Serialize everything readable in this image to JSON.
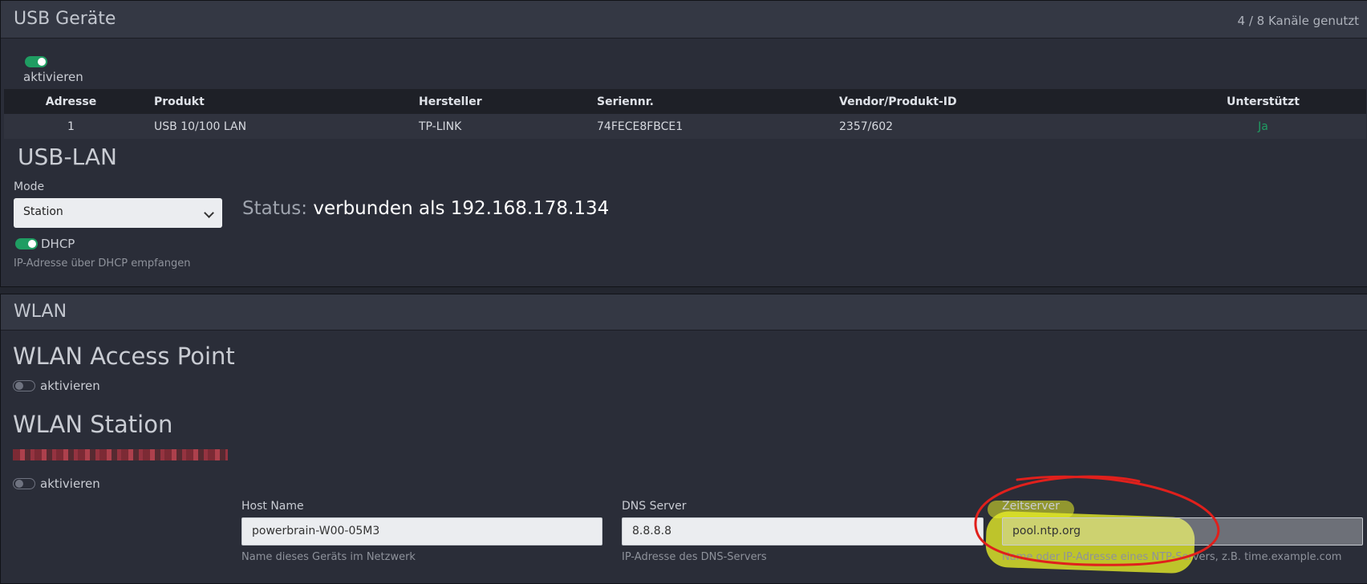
{
  "usb_panel": {
    "title": "USB Geräte",
    "channels": "4 / 8 Kanäle genutzt",
    "toggle_label": "aktivieren",
    "table": {
      "headers": [
        "Adresse",
        "Produkt",
        "Hersteller",
        "Seriennr.",
        "Vendor/Produkt-ID",
        "Unterstützt"
      ],
      "rows": [
        [
          "1",
          "USB 10/100 LAN",
          "TP-LINK",
          "74FECE8FBCE1",
          "2357/602",
          "Ja"
        ]
      ]
    },
    "usb_lan": {
      "title": "USB-LAN",
      "mode_label": "Mode",
      "mode_value": "Station",
      "status_label": "Status:",
      "status_value": "verbunden als 192.168.178.134",
      "dhcp_label": "DHCP",
      "dhcp_help": "IP-Adresse über DHCP empfangen"
    }
  },
  "wlan_panel": {
    "title": "WLAN",
    "ap": {
      "title": "WLAN Access Point",
      "toggle_label": "aktivieren"
    },
    "station": {
      "title": "WLAN Station",
      "toggle_label": "aktivieren"
    },
    "fields": {
      "host": {
        "label": "Host Name",
        "value": "powerbrain-W00-05M3",
        "help": "Name dieses Geräts im Netzwerk"
      },
      "dns": {
        "label": "DNS Server",
        "value": "8.8.8.8",
        "help": "IP-Adresse des DNS-Servers"
      },
      "ntp": {
        "label": "Zeitserver",
        "value": "pool.ntp.org",
        "help": "Name oder IP-Adresse eines NTP-Servers, z.B. time.example.com"
      }
    }
  },
  "colors": {
    "toggle_on": "#1f9d62",
    "supported_yes": "#1f9d62",
    "annotation_red": "#e0201c",
    "annotation_yellow": "#e8ee28"
  }
}
